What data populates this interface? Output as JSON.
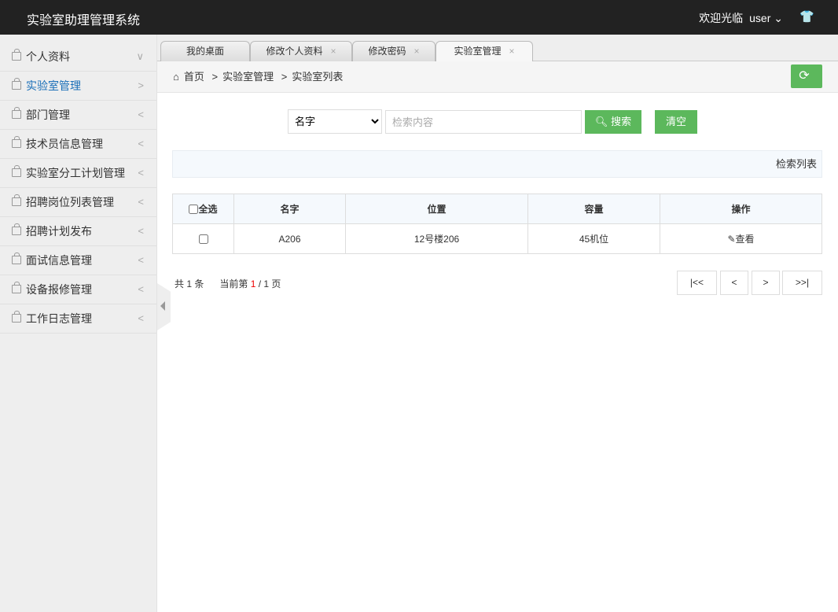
{
  "app_title": "实验室助理管理系统",
  "header": {
    "welcome": "欢迎光临",
    "user": "user"
  },
  "sidebar": {
    "items": [
      {
        "label": "个人资料",
        "arrow": "∨"
      },
      {
        "label": "实验室管理",
        "arrow": ">"
      },
      {
        "label": "部门管理",
        "arrow": "<"
      },
      {
        "label": "技术员信息管理",
        "arrow": "<"
      },
      {
        "label": "实验室分工计划管理",
        "arrow": "<"
      },
      {
        "label": "招聘岗位列表管理",
        "arrow": "<"
      },
      {
        "label": "招聘计划发布",
        "arrow": "<"
      },
      {
        "label": "面试信息管理",
        "arrow": "<"
      },
      {
        "label": "设备报修管理",
        "arrow": "<"
      },
      {
        "label": "工作日志管理",
        "arrow": "<"
      }
    ]
  },
  "tabs": [
    {
      "label": "我的桌面"
    },
    {
      "label": "修改个人资料"
    },
    {
      "label": "修改密码"
    },
    {
      "label": "实验室管理"
    }
  ],
  "breadcrumb": [
    "首页",
    "实验室管理",
    "实验室列表"
  ],
  "search": {
    "field": "名字",
    "placeholder": "检索内容",
    "search_label": "搜索",
    "clear_label": "清空"
  },
  "info_label": "检索列表",
  "table": {
    "headers": [
      "全选",
      "名字",
      "位置",
      "容量",
      "操作"
    ],
    "rows": [
      {
        "name": "A206",
        "location": "12号楼206",
        "capacity": "45机位",
        "action": "查看"
      }
    ]
  },
  "pagination": {
    "total": "共 1 条",
    "current_prefix": "当前第",
    "current": "1",
    "total_pages": "/ 1 页",
    "first": "|<<",
    "prev": "<",
    "next": ">",
    "last": ">>|"
  },
  "colors": {
    "accent": "#5cb85c",
    "header": "#222222",
    "active": "#1a6fb8"
  }
}
